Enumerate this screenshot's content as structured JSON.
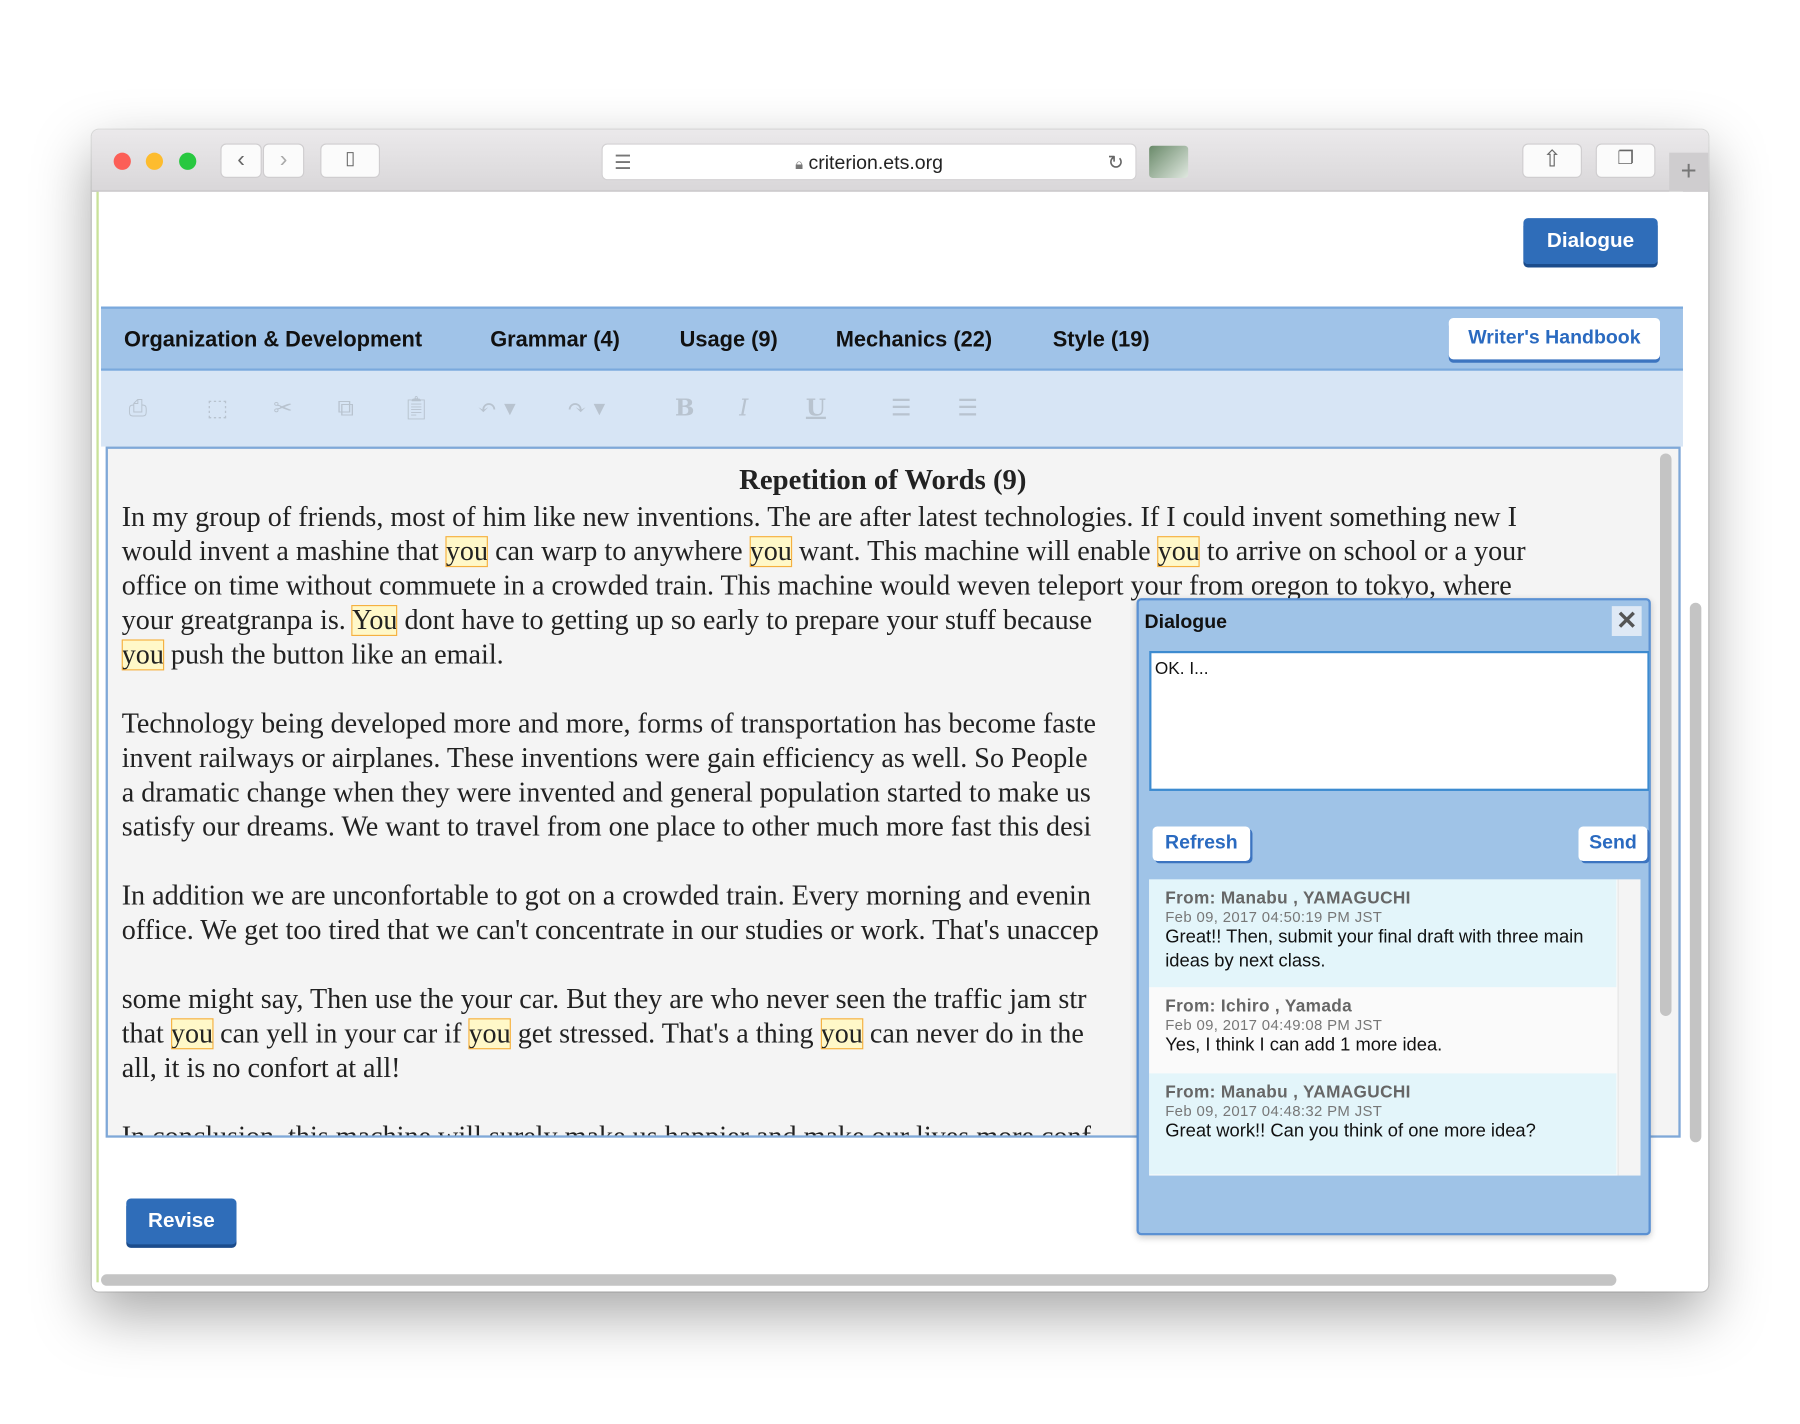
{
  "browser": {
    "url": "criterion.ets.org"
  },
  "header": {
    "dialogue_button": "Dialogue"
  },
  "nav": {
    "items": [
      "Organization & Development",
      "Grammar (4)",
      "Usage (9)",
      "Mechanics (22)",
      "Style (19)"
    ],
    "writers_handbook": "Writer's Handbook"
  },
  "toolbar": {
    "icons": [
      "print-icon",
      "select-all-icon",
      "cut-icon",
      "copy-icon",
      "paste-icon",
      "undo-icon",
      "redo-icon",
      "bold-icon",
      "italic-icon",
      "underline-icon",
      "bullet-list-icon",
      "numbered-list-icon"
    ]
  },
  "editor": {
    "title": "Repetition of Words (9)",
    "highlight_color": "#fff8c8",
    "lines": [
      [
        [
          "In my group of friends, most of him like new inventions. The are after latest technologies. If I could invent something new I",
          0
        ]
      ],
      [
        [
          "would invent a mashine that ",
          0
        ],
        [
          "you",
          1
        ],
        [
          " can warp to anywhere ",
          0
        ],
        [
          "you",
          1
        ],
        [
          " want. This machine will enable ",
          0
        ],
        [
          "you",
          1
        ],
        [
          " to arrive on school or a your",
          0
        ]
      ],
      [
        [
          "office on time without commuete in a crowded train. This machine would weven teleport your from oregon to tokyo, where",
          0
        ]
      ],
      [
        [
          "your greatgranpa is. ",
          0
        ],
        [
          "You",
          1
        ],
        [
          " dont have to getting up so early to prepare your stuff because",
          0
        ]
      ],
      [
        [
          "you",
          1
        ],
        [
          " push the button like an email.",
          0
        ]
      ],
      [],
      [
        [
          "Technology being developed more and more, forms of transportation has become faste",
          0
        ]
      ],
      [
        [
          "invent railways or airplanes. These inventions were gain efficiency as well. So People",
          0
        ]
      ],
      [
        [
          "a dramatic change when they were invented and general population started to make us",
          0
        ]
      ],
      [
        [
          "satisfy our dreams. We want to travel from one place to other much more fast this desi",
          0
        ]
      ],
      [],
      [
        [
          "In addition we are unconfortable to got on a crowded train. Every morning and evenin",
          0
        ]
      ],
      [
        [
          "office. We get too tired that we can't concentrate in our studies or work. That's unaccep",
          0
        ]
      ],
      [],
      [
        [
          "some might say, Then use the your car. But they are who never seen the traffic jam str",
          0
        ]
      ],
      [
        [
          "that ",
          0
        ],
        [
          "you",
          1
        ],
        [
          " can yell in your car if ",
          0
        ],
        [
          "you",
          1
        ],
        [
          " get stressed. That's a thing ",
          0
        ],
        [
          "you",
          1
        ],
        [
          " can never do in the",
          0
        ]
      ],
      [
        [
          "all, it is no confort at all!",
          0
        ]
      ],
      [],
      [
        [
          "In conclusion, this machine will surely make us happier and make our lives more conf",
          0
        ]
      ]
    ]
  },
  "revise_button": "Revise",
  "dialog": {
    "title": "Dialogue",
    "textarea_value": "OK. I...",
    "refresh": "Refresh",
    "send": "Send",
    "messages": [
      {
        "from": "From: Manabu , YAMAGUCHI",
        "date": "Feb 09, 2017 04:50:19 PM JST",
        "body": "Great!! Then, submit your final draft with three main ideas by next class.",
        "bg": "#e3f5fa"
      },
      {
        "from": "From: Ichiro , Yamada",
        "date": "Feb 09, 2017 04:49:08 PM JST",
        "body": "Yes, I think I can add 1 more idea.",
        "bg": "#fafafa"
      },
      {
        "from": "From: Manabu , YAMAGUCHI",
        "date": "Feb 09, 2017 04:48:32 PM JST",
        "body": "Great work!! Can you think of one more idea?",
        "bg": "#e3f5fa"
      }
    ]
  }
}
